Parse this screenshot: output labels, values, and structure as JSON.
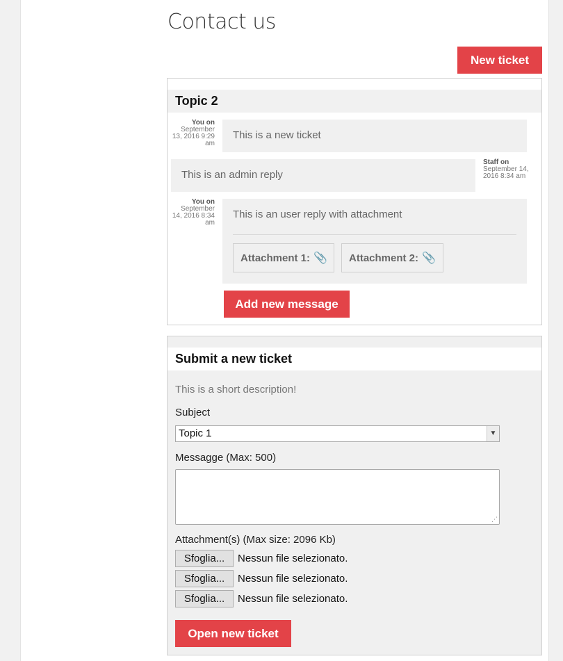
{
  "page": {
    "title": "Contact us"
  },
  "toolbar": {
    "new_ticket_label": "New ticket"
  },
  "topic": {
    "title": "Topic 2",
    "messages": [
      {
        "who": "You on",
        "date": "September 13, 2016 9:29 am",
        "text": "This is a new ticket"
      },
      {
        "who": "Staff on",
        "date": "September 14, 2016 8:34 am",
        "text": "This is an admin reply"
      },
      {
        "who": "You on",
        "date": "September 14, 2016 8:34 am",
        "text": "This is an user reply with attachment",
        "attachments": [
          {
            "label": "Attachment 1:"
          },
          {
            "label": "Attachment 2:"
          }
        ]
      }
    ],
    "add_message_label": "Add new message"
  },
  "form": {
    "title": "Submit a new ticket",
    "description": "This is a short description!",
    "subject_label": "Subject",
    "subject_value": "Topic 1",
    "message_label": "Messagge (Max: 500)",
    "message_value": "",
    "attachments_label": "Attachment(s) (Max size: 2096 Kb)",
    "files": [
      {
        "button": "Sfoglia...",
        "status": "Nessun file selezionato."
      },
      {
        "button": "Sfoglia...",
        "status": "Nessun file selezionato."
      },
      {
        "button": "Sfoglia...",
        "status": "Nessun file selezionato."
      }
    ],
    "submit_label": "Open new ticket"
  },
  "colors": {
    "accent": "#e34348",
    "panel_bg": "#f0f0f0"
  },
  "icons": {
    "attachment": "paperclip-icon",
    "select_arrow": "chevron-down-icon"
  }
}
